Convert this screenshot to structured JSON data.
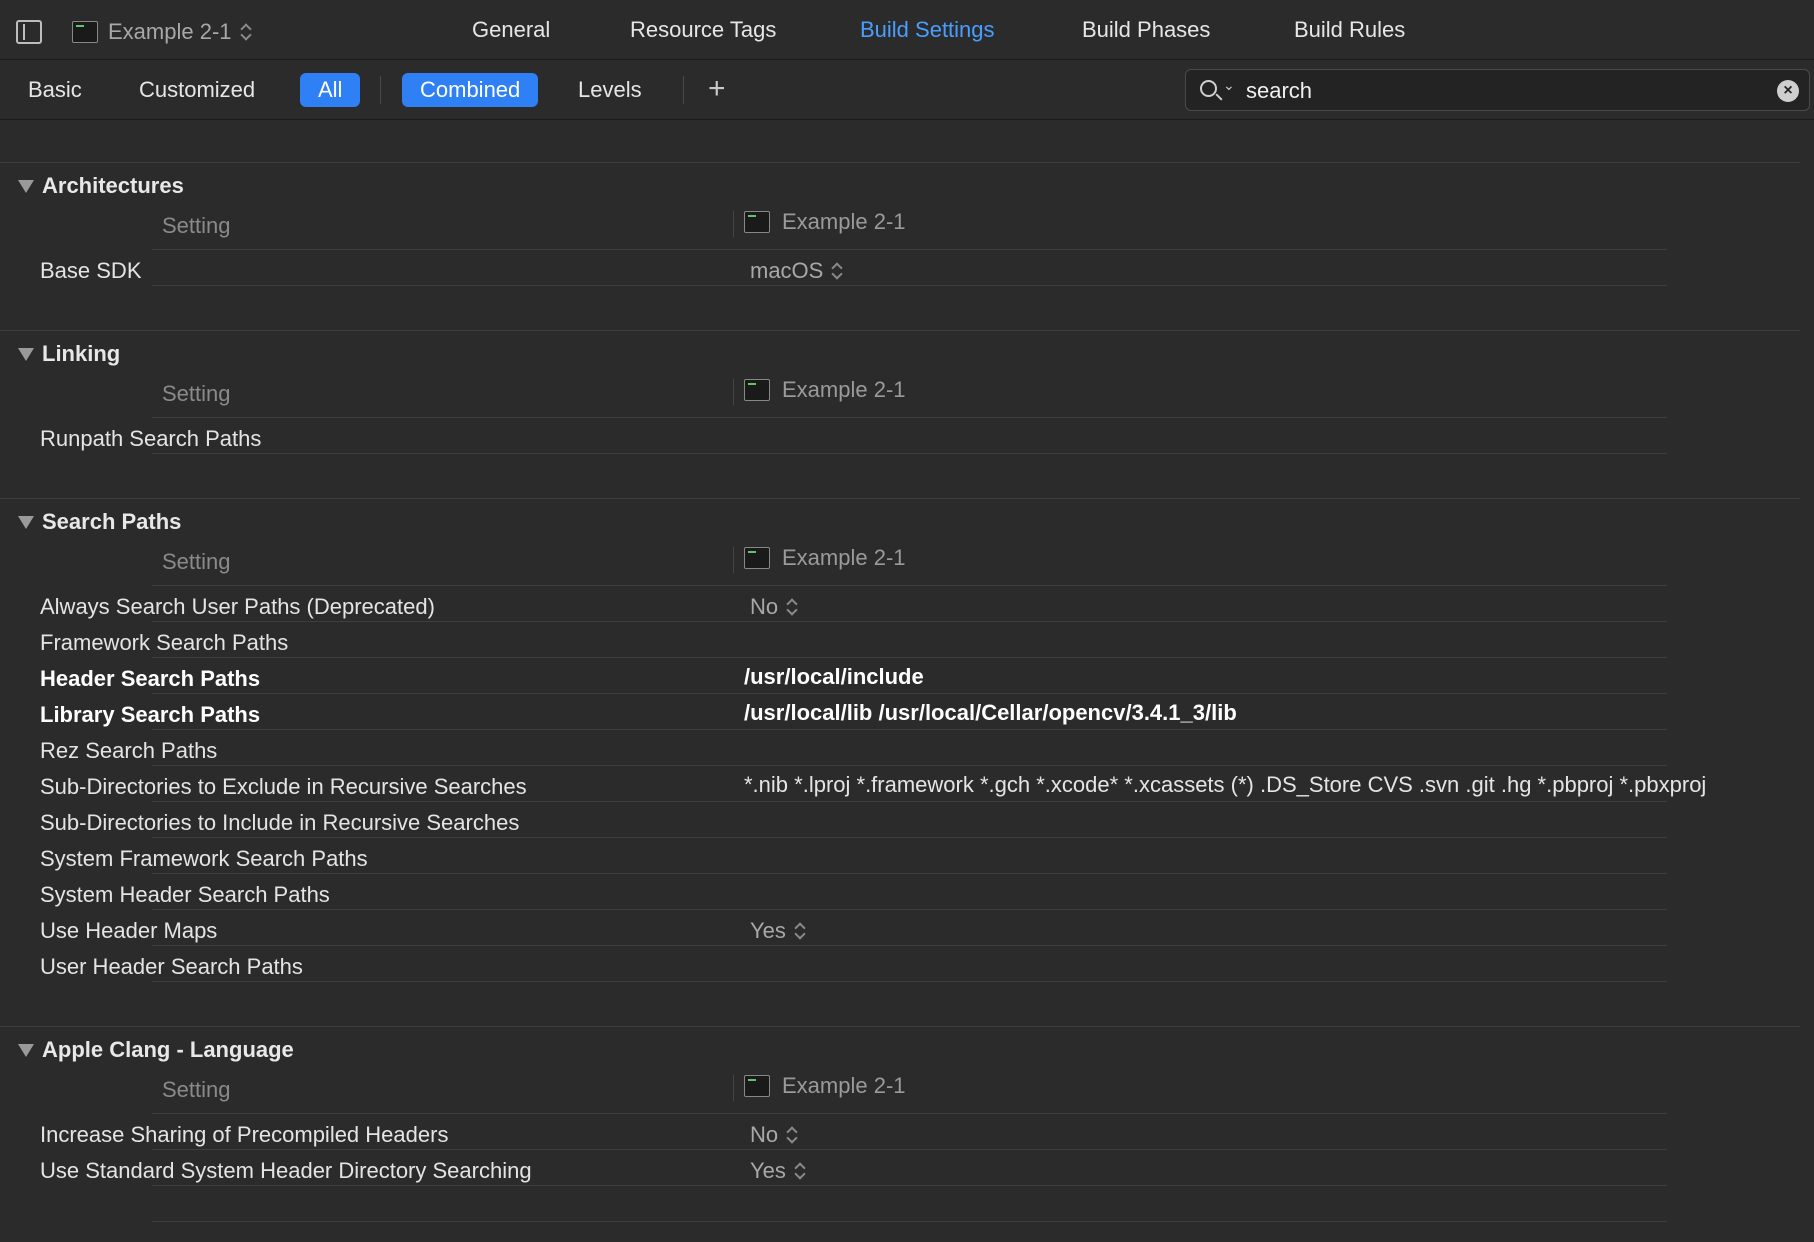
{
  "toolbar": {
    "target_label": "Example 2-1",
    "tabs": [
      "General",
      "Resource Tags",
      "Build Settings",
      "Build Phases",
      "Build Rules"
    ],
    "active_tab": "Build Settings"
  },
  "filterbar": {
    "basic": "Basic",
    "customized": "Customized",
    "all": "All",
    "combined": "Combined",
    "levels": "Levels",
    "add": "+"
  },
  "search": {
    "value": "search",
    "clear": "×"
  },
  "columns": {
    "setting": "Setting",
    "target": "Example 2-1"
  },
  "sections": {
    "architectures": {
      "title": "Architectures",
      "rows": [
        {
          "name": "Base SDK",
          "value": "macOS"
        }
      ]
    },
    "linking": {
      "title": "Linking",
      "rows": [
        {
          "name": "Runpath Search Paths",
          "value": ""
        }
      ]
    },
    "search_paths": {
      "title": "Search Paths",
      "rows": [
        {
          "name": "Always Search User Paths (Deprecated)",
          "value": "No"
        },
        {
          "name": "Framework Search Paths",
          "value": ""
        },
        {
          "name": "Header Search Paths",
          "value": "/usr/local/include"
        },
        {
          "name": "Library Search Paths",
          "value": "/usr/local/lib /usr/local/Cellar/opencv/3.4.1_3/lib"
        },
        {
          "name": "Rez Search Paths",
          "value": ""
        },
        {
          "name": "Sub-Directories to Exclude in Recursive Searches",
          "value": "*.nib *.lproj *.framework *.gch *.xcode* *.xcassets (*) .DS_Store CVS .svn .git .hg *.pbproj *.pbxproj"
        },
        {
          "name": "Sub-Directories to Include in Recursive Searches",
          "value": ""
        },
        {
          "name": "System Framework Search Paths",
          "value": ""
        },
        {
          "name": "System Header Search Paths",
          "value": ""
        },
        {
          "name": "Use Header Maps",
          "value": "Yes"
        },
        {
          "name": "User Header Search Paths",
          "value": ""
        }
      ]
    },
    "clang_language": {
      "title": "Apple Clang - Language",
      "rows": [
        {
          "name": "Increase Sharing of Precompiled Headers",
          "value": "No"
        },
        {
          "name": "Use Standard System Header Directory Searching",
          "value": "Yes"
        }
      ]
    }
  }
}
